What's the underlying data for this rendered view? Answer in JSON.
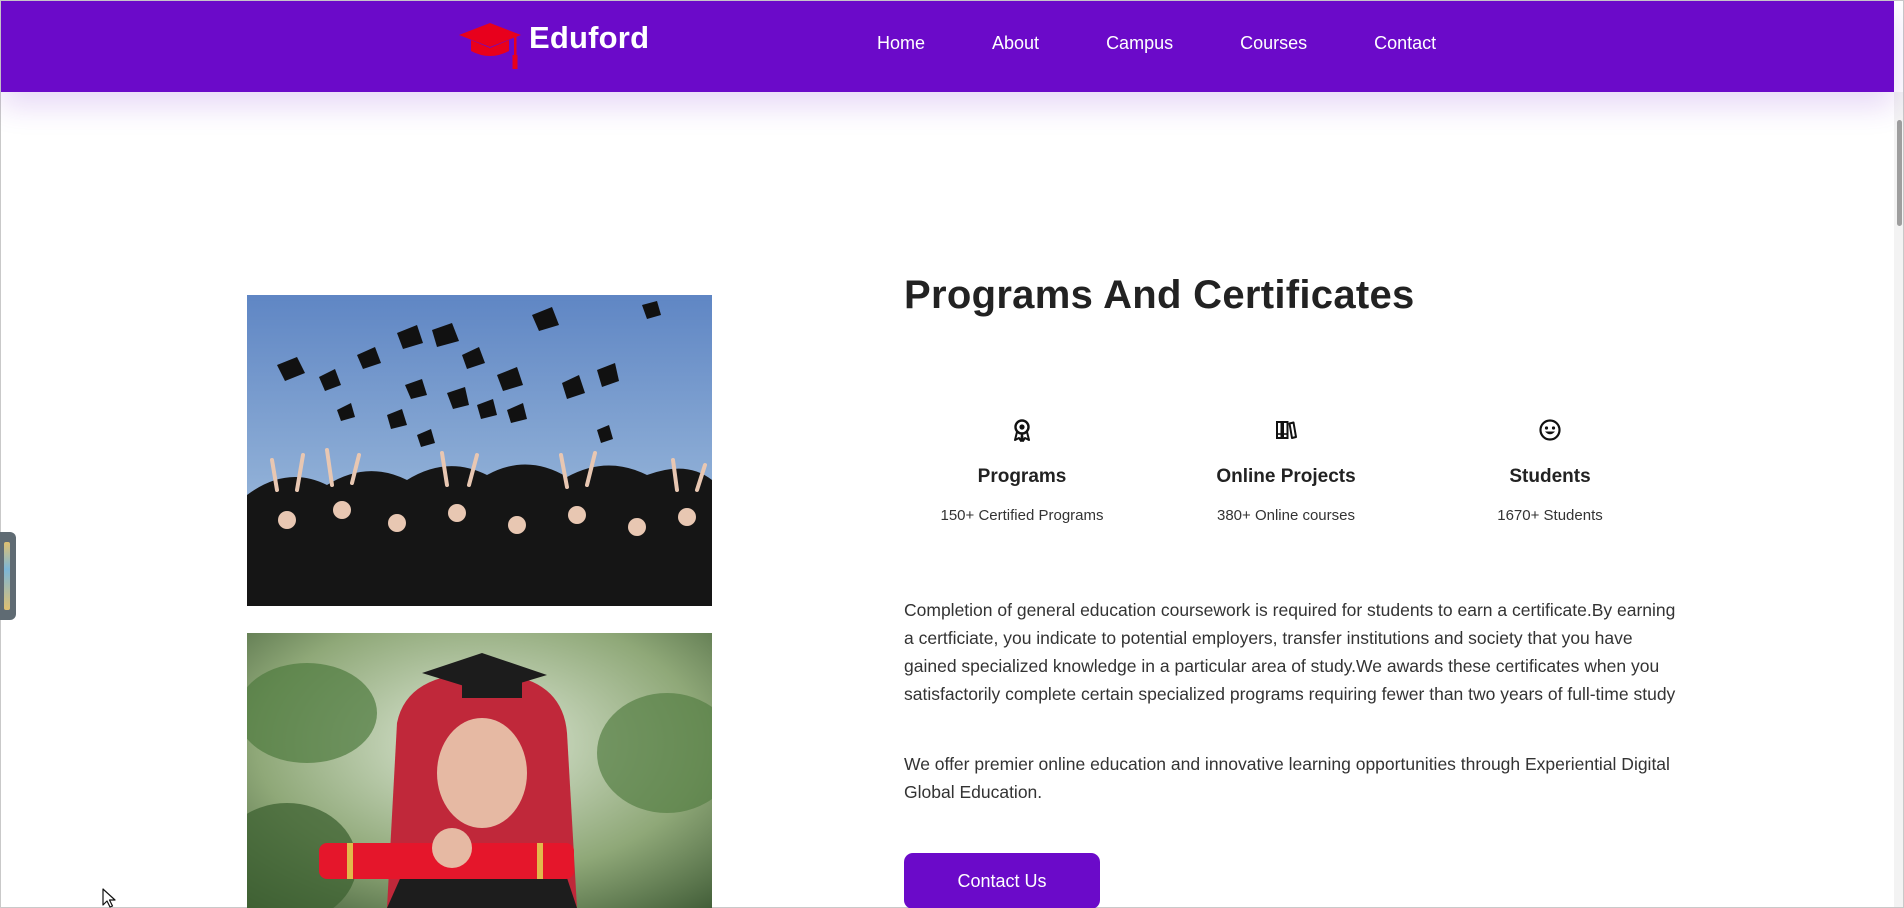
{
  "navbar": {
    "brand": "Eduford",
    "brand_icon": "graduation-cap-icon",
    "background": "#6b0ac9",
    "links": [
      "Home",
      "About",
      "Campus",
      "Courses",
      "Contact"
    ]
  },
  "section": {
    "title": "Programs And Certificates",
    "stats": [
      {
        "icon": "award-ribbon-icon",
        "title": "Programs",
        "subtitle": "150+ Certified Programs"
      },
      {
        "icon": "books-icon",
        "title": "Online Projects",
        "subtitle": "380+ Online courses"
      },
      {
        "icon": "smiley-face-icon",
        "title": "Students",
        "subtitle": "1670+ Students"
      }
    ],
    "paragraphs": [
      "Completion of general education coursework is required for students to earn a certificate.By earning a certficiate, you indicate to potential employers, transfer institutions and society that you have gained specialized knowledge in a particular area of study.We awards these certificates when you satisfactorily complete certain specialized programs requiring fewer than two years of full-time study",
      "We offer premier online education and innovative learning opportunities through Experiential Digital Global Education."
    ],
    "cta_label": "Contact Us"
  },
  "colors": {
    "accent": "#6b0ac9",
    "cap_red": "#e8001c"
  }
}
